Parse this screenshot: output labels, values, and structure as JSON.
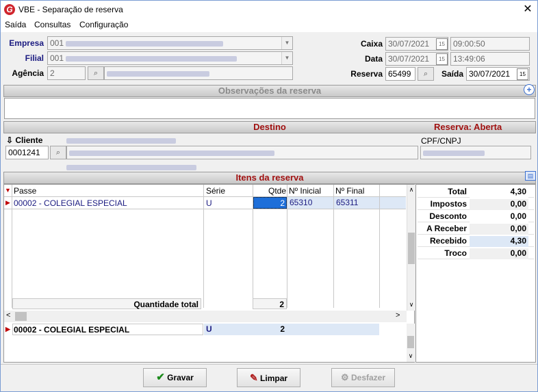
{
  "window": {
    "title": "VBE - Separação de reserva"
  },
  "menu": [
    "Saída",
    "Consultas",
    "Configuração"
  ],
  "header": {
    "empresa_label": "Empresa",
    "empresa_code": "001",
    "filial_label": "Filial",
    "filial_code": "001",
    "agencia_label": "Agência",
    "agencia_code": "2",
    "caixa_label": "Caixa",
    "caixa_date": "30/07/2021",
    "caixa_time": "09:00:50",
    "data_label": "Data",
    "data_date": "30/07/2021",
    "data_time": "13:49:06",
    "reserva_label": "Reserva",
    "reserva_value": "65499",
    "saida_label": "Saída",
    "saida_date": "30/07/2021"
  },
  "observacoes": {
    "title": "Observações da reserva"
  },
  "destino": {
    "title": "Destino",
    "status": "Reserva: Aberta"
  },
  "cliente": {
    "label": "Cliente",
    "code": "0001241",
    "cpf_label": "CPF/CNPJ"
  },
  "itens": {
    "title": "Itens da reserva",
    "columns": [
      "Passe",
      "Série",
      "Qtde",
      "Nº Inicial",
      "Nº Final"
    ],
    "rows": [
      {
        "passe": "00002 - COLEGIAL ESPECIAL",
        "serie": "U",
        "qtde": "2",
        "inicial": "65310",
        "final": "65311"
      }
    ],
    "total_label": "Quantidade total",
    "total_value": "2",
    "summary": {
      "passe": "00002 - COLEGIAL ESPECIAL",
      "serie": "U",
      "qtde": "2"
    }
  },
  "totals": [
    {
      "label": "Total",
      "value": "4,30"
    },
    {
      "label": "Impostos",
      "value": "0,00"
    },
    {
      "label": "Desconto",
      "value": "0,00"
    },
    {
      "label": "A Receber",
      "value": "0,00"
    },
    {
      "label": "Recebido",
      "value": "4,30"
    },
    {
      "label": "Troco",
      "value": "0,00"
    }
  ],
  "buttons": {
    "gravar": "Gravar",
    "limpar": "Limpar",
    "desfazer": "Desfazer"
  },
  "colors": {
    "accent_red": "#a01010",
    "label_blue": "#1a1a80",
    "selection": "#1e6fd9"
  }
}
